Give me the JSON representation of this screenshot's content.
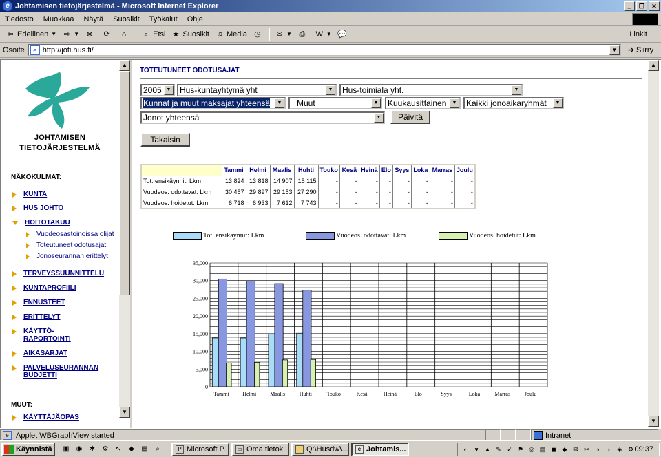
{
  "window": {
    "title": "Johtamisen tietojärjestelmä - Microsoft Internet Explorer"
  },
  "menu": [
    "Tiedosto",
    "Muokkaa",
    "Näytä",
    "Suosikit",
    "Työkalut",
    "Ohje"
  ],
  "toolbar": {
    "back": "Edellinen",
    "search": "Etsi",
    "favorites": "Suosikit",
    "media": "Media",
    "links": "Linkit"
  },
  "address": {
    "label": "Osoite",
    "url": "http://joti.hus.fi/",
    "go": "Siirry"
  },
  "sidebar": {
    "app_title_line1": "JOHTAMISEN",
    "app_title_line2": "TIETOJÄRJESTELMÄ",
    "section1": "NÄKÖKULMAT:",
    "items": [
      {
        "label": "KUNTA"
      },
      {
        "label": "HUS JOHTO"
      },
      {
        "label": "HOITOTAKUU"
      },
      {
        "label": "TERVEYSSUUNNITTELU"
      },
      {
        "label": "KUNTAPROFIILI"
      },
      {
        "label": "ENNUSTEET"
      },
      {
        "label": "ERITTELYT"
      },
      {
        "label_line1": "KÄYTTÖ-",
        "label_line2": "RAPORTOINTI"
      },
      {
        "label": "AIKASARJAT"
      },
      {
        "label_line1": "PALVELUSEURANNAN",
        "label_line2": "BUDJETTI"
      }
    ],
    "subitems": [
      {
        "label": "Vuodeosastoinoissa olijat"
      },
      {
        "label": "Toteutuneet odotusajat"
      },
      {
        "label": "Jonoseurannan erittelyt"
      }
    ],
    "section2": "MUUT:",
    "cut_item": "KÄYTTÄJÄOPAS"
  },
  "main": {
    "title": "TOTEUTUNEET ODOTUSAJAT",
    "filters": {
      "year": "2005",
      "kunta": "Hus-kuntayhtymä yht",
      "toimiala": "Hus-toimiala yht.",
      "maksaja": "Kunnat ja muut maksajat yhteensä",
      "muut": "Muut",
      "jakso": "Kuukausittainen",
      "jonoaika": "Kaikki jonoaikaryhmät",
      "jonot": "Jonot yhteensä"
    },
    "update_button": "Päivitä",
    "back_button": "Takaisin"
  },
  "table": {
    "months": [
      "Tammi",
      "Helmi",
      "Maalis",
      "Huhti",
      "Touko",
      "Kesä",
      "Heinä",
      "Elo",
      "Syys",
      "Loka",
      "Marras",
      "Joulu"
    ],
    "rows": [
      {
        "label": "Tot. ensikäynnit: Lkm",
        "cells": [
          "13 824",
          "13 818",
          "14 907",
          "15 115",
          "-",
          "-",
          "-",
          "-",
          "-",
          "-",
          "-",
          "-"
        ]
      },
      {
        "label": "Vuodeos. odottavat: Lkm",
        "cells": [
          "30 457",
          "29 897",
          "29 153",
          "27 290",
          "-",
          "-",
          "-",
          "-",
          "-",
          "-",
          "-",
          "-"
        ]
      },
      {
        "label": "Vuodeos. hoidetut: Lkm",
        "cells": [
          "6 718",
          "6 933",
          "7 612",
          "7 743",
          "-",
          "-",
          "-",
          "-",
          "-",
          "-",
          "-",
          "-"
        ]
      }
    ]
  },
  "chart_data": {
    "type": "bar",
    "categories": [
      "Tammi",
      "Helmi",
      "Maalis",
      "Huhti",
      "Touko",
      "Kesä",
      "Heinä",
      "Elo",
      "Syys",
      "Loka",
      "Marras",
      "Joulu"
    ],
    "series": [
      {
        "name": "Tot. ensikäynnit: Lkm",
        "color": "#a8dcf8",
        "values": [
          13824,
          13818,
          14907,
          15115,
          null,
          null,
          null,
          null,
          null,
          null,
          null,
          null
        ]
      },
      {
        "name": "Vuodeos. odottavat: Lkm",
        "color": "#8898e0",
        "values": [
          30457,
          29897,
          29153,
          27290,
          null,
          null,
          null,
          null,
          null,
          null,
          null,
          null
        ]
      },
      {
        "name": "Vuodeos. hoidetut: Lkm",
        "color": "#d8f0b0",
        "values": [
          6718,
          6933,
          7612,
          7743,
          null,
          null,
          null,
          null,
          null,
          null,
          null,
          null
        ]
      }
    ],
    "ylim": [
      0,
      35000
    ],
    "yticks": [
      "0",
      "5,000",
      "10,000",
      "15,000",
      "20,000",
      "25,000",
      "30,000",
      "35,000"
    ],
    "ytick_values": [
      0,
      5000,
      10000,
      15000,
      20000,
      25000,
      30000,
      35000
    ],
    "minor_step": 1000,
    "grid": true,
    "legend": "top"
  },
  "status": {
    "message": "Applet WBGraphView started",
    "zone": "Intranet"
  },
  "taskbar": {
    "start": "Käynnistä",
    "tasks": [
      "Microsoft P...",
      "Oma tietok...",
      "Q:\\Husdw\\...",
      "Johtamis..."
    ],
    "clock": "09:37"
  }
}
